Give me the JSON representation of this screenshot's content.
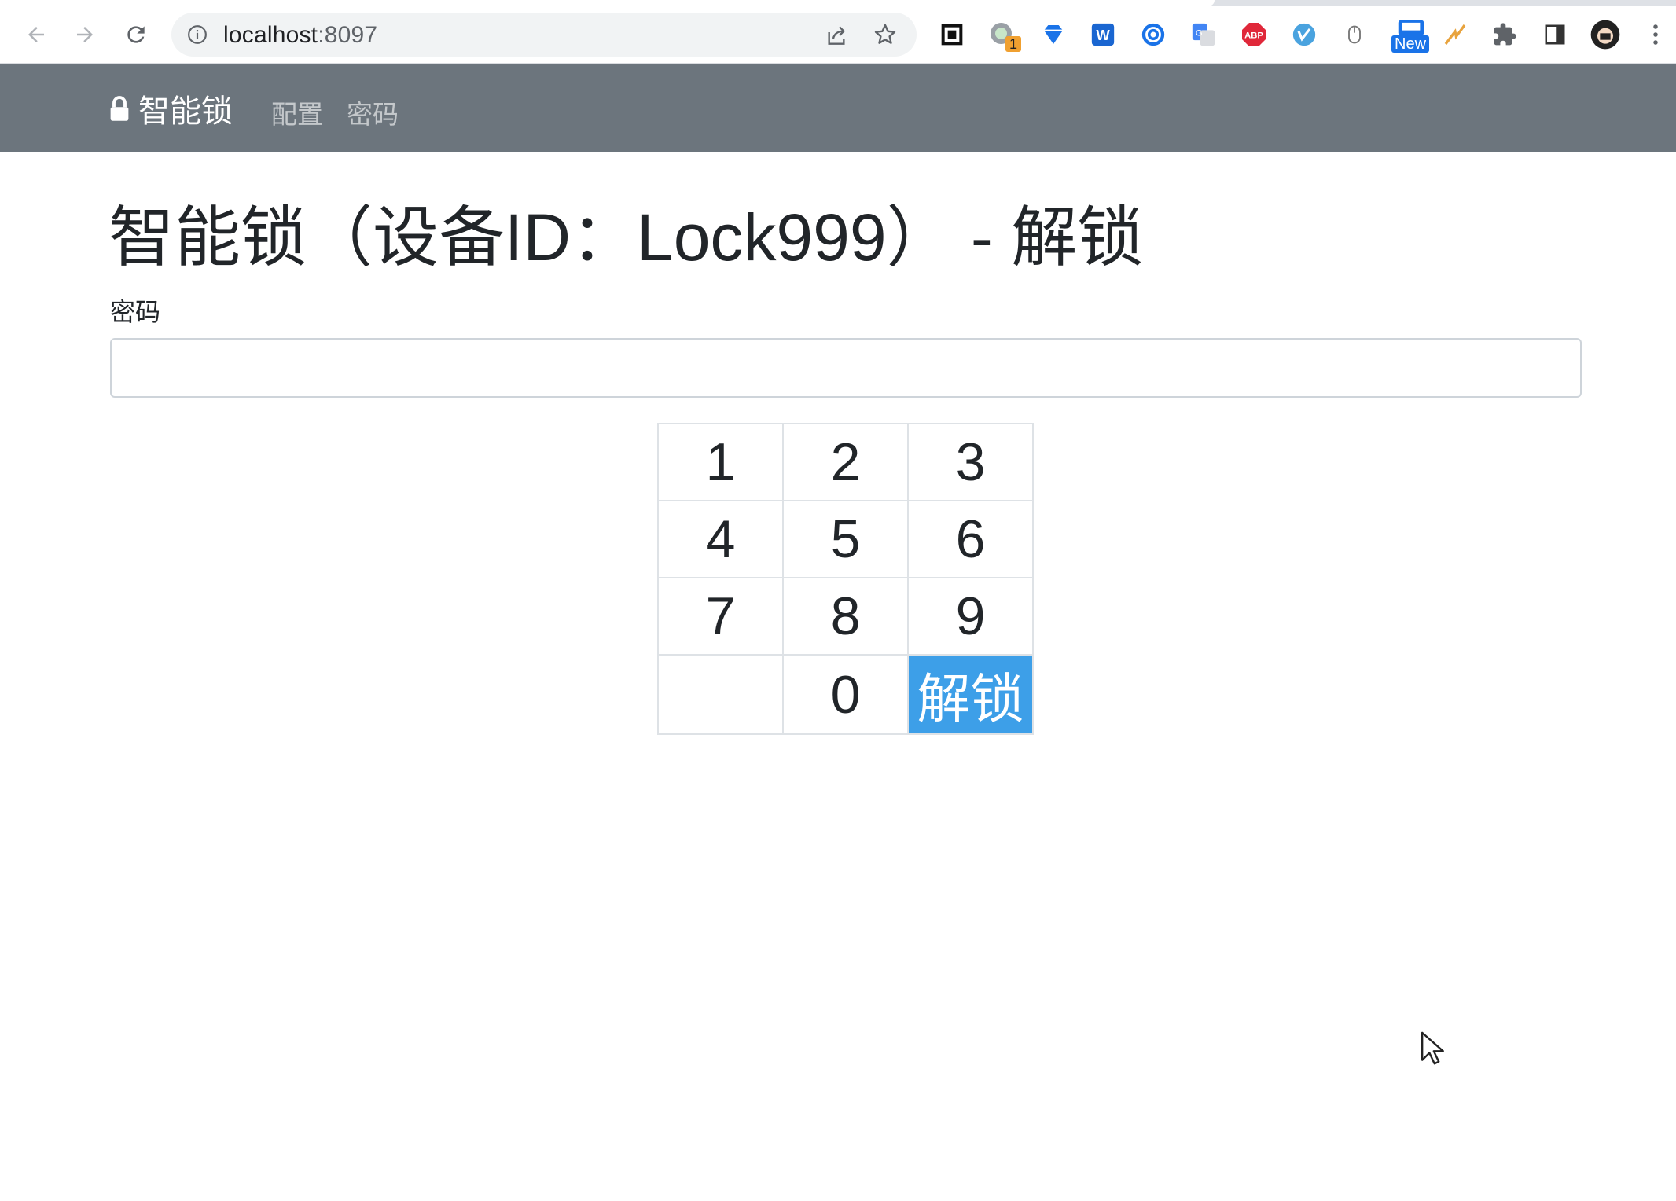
{
  "browser": {
    "url_host": "localhost",
    "url_port": ":8097",
    "extensions": [
      "qr-code-icon",
      "chrome-extension-badge-icon",
      "vpn-diamond-icon",
      "word-icon",
      "grammarly-icon",
      "google-translate-icon",
      "adblock-plus-icon",
      "vimeo-icon",
      "mouse-icon",
      "new-extension-icon",
      "lightning-icon",
      "puzzle-icon",
      "side-panel-icon",
      "profile-avatar"
    ],
    "badge_count": "1",
    "new_badge": "New"
  },
  "navbar": {
    "brand": "智能锁",
    "links": [
      "配置",
      "密码"
    ]
  },
  "main": {
    "title": "智能锁（设备ID：Lock999） - 解锁",
    "password_label": "密码",
    "password_value": ""
  },
  "keypad": {
    "rows": [
      [
        "1",
        "2",
        "3"
      ],
      [
        "4",
        "5",
        "6"
      ],
      [
        "7",
        "8",
        "9"
      ],
      [
        "",
        "0",
        "解锁"
      ]
    ]
  },
  "colors": {
    "navbar_bg": "#6c757d",
    "unlock_button": "#3d9fe8"
  }
}
